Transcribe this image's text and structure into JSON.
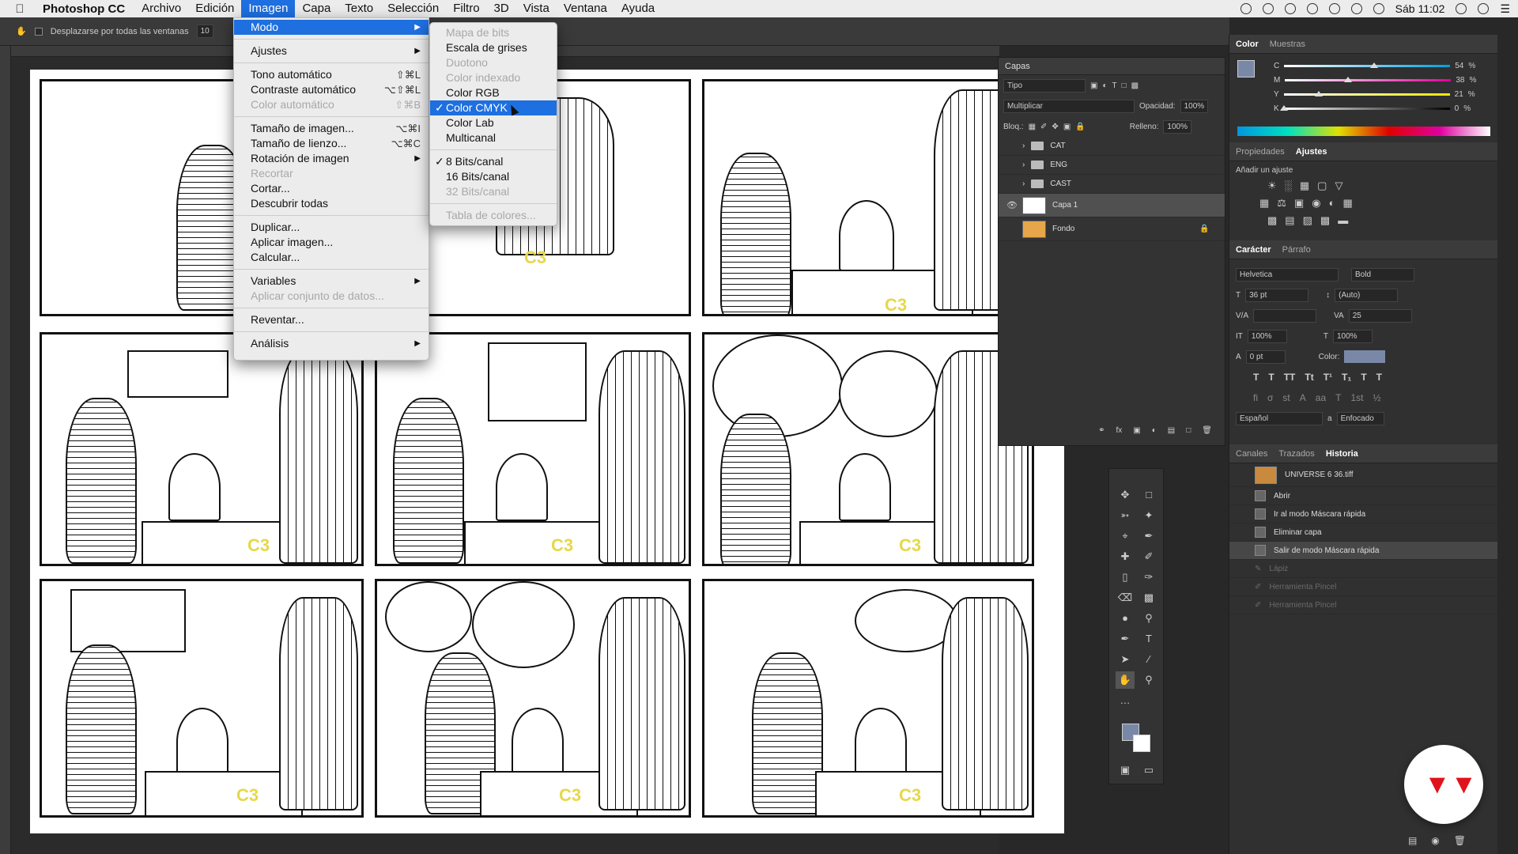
{
  "menubar": {
    "app": "Photoshop CC",
    "items": [
      "Archivo",
      "Edición",
      "Imagen",
      "Capa",
      "Texto",
      "Selección",
      "Filtro",
      "3D",
      "Vista",
      "Ventana",
      "Ayuda"
    ],
    "clock": "Sáb 11:02"
  },
  "options": {
    "scroll_all": "Desplazarse por todas las ventanas",
    "zoom": "10"
  },
  "imagen_menu": [
    {
      "label": "Modo",
      "hl": true,
      "sub": true
    },
    {
      "sep": true
    },
    {
      "label": "Ajustes",
      "sub": true
    },
    {
      "sep": true
    },
    {
      "label": "Tono automático",
      "sc": "⇧⌘L"
    },
    {
      "label": "Contraste automático",
      "sc": "⌥⇧⌘L"
    },
    {
      "label": "Color automático",
      "sc": "⇧⌘B",
      "dis": true
    },
    {
      "sep": true
    },
    {
      "label": "Tamaño de imagen...",
      "sc": "⌥⌘I"
    },
    {
      "label": "Tamaño de lienzo...",
      "sc": "⌥⌘C"
    },
    {
      "label": "Rotación de imagen",
      "sub": true
    },
    {
      "label": "Recortar",
      "dis": true
    },
    {
      "label": "Cortar..."
    },
    {
      "label": "Descubrir todas"
    },
    {
      "sep": true
    },
    {
      "label": "Duplicar..."
    },
    {
      "label": "Aplicar imagen..."
    },
    {
      "label": "Calcular..."
    },
    {
      "sep": true
    },
    {
      "label": "Variables",
      "sub": true
    },
    {
      "label": "Aplicar conjunto de datos...",
      "dis": true
    },
    {
      "sep": true
    },
    {
      "label": "Reventar..."
    },
    {
      "sep": true
    },
    {
      "label": "Análisis",
      "sub": true
    }
  ],
  "modo_menu": [
    {
      "label": "Mapa de bits",
      "dis": true
    },
    {
      "label": "Escala de grises"
    },
    {
      "label": "Duotono",
      "dis": true
    },
    {
      "label": "Color indexado",
      "dis": true
    },
    {
      "label": "Color RGB"
    },
    {
      "label": "Color CMYK",
      "checked": true,
      "hl": true
    },
    {
      "label": "Color Lab"
    },
    {
      "label": "Multicanal"
    },
    {
      "sep": true
    },
    {
      "label": "8 Bits/canal",
      "checked": true
    },
    {
      "label": "16 Bits/canal"
    },
    {
      "label": "32 Bits/canal",
      "dis": true
    },
    {
      "sep": true
    },
    {
      "label": "Tabla de colores...",
      "dis": true
    }
  ],
  "layers": {
    "tab": "Capas",
    "filter": "Tipo",
    "blend": "Multiplicar",
    "opacity_label": "Opacidad:",
    "opacity": "100%",
    "lock_label": "Bloq.:",
    "fill_label": "Relleno:",
    "fill": "100%",
    "items": [
      {
        "name": "CAT",
        "folder": true
      },
      {
        "name": "ENG",
        "folder": true
      },
      {
        "name": "CAST",
        "folder": true
      },
      {
        "name": "Capa 1",
        "sel": true,
        "eye": true
      },
      {
        "name": "Fondo",
        "lock": true
      }
    ]
  },
  "color": {
    "tabs": [
      "Color",
      "Muestras"
    ],
    "channels": [
      {
        "ch": "C",
        "val": "54",
        "pct": 54
      },
      {
        "ch": "M",
        "val": "38",
        "pct": 38
      },
      {
        "ch": "Y",
        "val": "21",
        "pct": 21
      },
      {
        "ch": "K",
        "val": "0",
        "pct": 0
      }
    ],
    "unit": "%",
    "swatch": "#7a88a8"
  },
  "adjust": {
    "tabs": [
      "Propiedades",
      "Ajustes"
    ],
    "title": "Añadir un ajuste"
  },
  "character": {
    "tabs": [
      "Carácter",
      "Párrafo"
    ],
    "font": "Helvetica",
    "style": "Bold",
    "size": "36 pt",
    "leading": "(Auto)",
    "tracking": "25",
    "vscale": "100%",
    "hscale": "100%",
    "baseline": "0 pt",
    "color_label": "Color:",
    "lang": "Español",
    "aa": "Enfocado"
  },
  "history": {
    "tabs": [
      "Canales",
      "Trazados",
      "Historia"
    ],
    "doc": "UNIVERSE 6 36.tiff",
    "items": [
      {
        "label": "Abrir"
      },
      {
        "label": "Ir al modo Máscara rápida"
      },
      {
        "label": "Eliminar capa"
      },
      {
        "label": "Salir de modo Máscara rápida",
        "sel": true
      },
      {
        "label": "Lápiz",
        "dis": true
      },
      {
        "label": "Herramienta Pincel",
        "dis": true
      },
      {
        "label": "Herramienta Pincel",
        "dis": true
      }
    ]
  },
  "comic": {
    "label": "C3"
  },
  "colors": {
    "accent": "#1e6fe0",
    "brand": "#e0121b"
  }
}
